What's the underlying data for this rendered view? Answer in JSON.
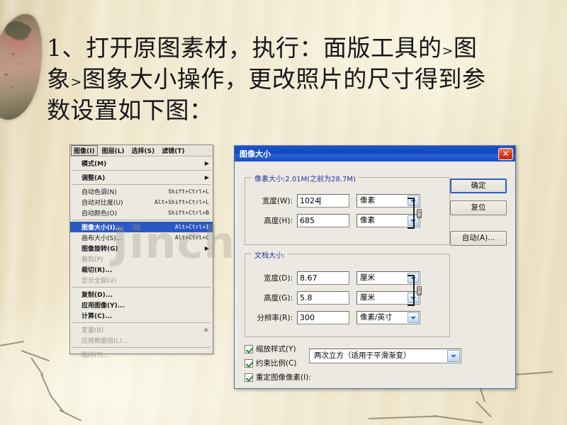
{
  "slide": {
    "headline_line1": "1、打开原图素材，执行：面版工具的",
    "headline_small1": ">",
    "headline_line1b": "图",
    "headline_line2a": "象",
    "headline_small2": ">",
    "headline_line2b": "图象大小操作，更改照片的尺寸得到参",
    "headline_line3": "数设置如下图：",
    "watermark": "Jinchutou.com",
    "accent_blue": "#1147bd",
    "highlight_blue": "#2b59c4",
    "paper_color": "#efe6c9"
  },
  "menu_panel": {
    "menubar": [
      {
        "label": "图像(I)",
        "selected": true
      },
      {
        "label": "图层(L)",
        "selected": false
      },
      {
        "label": "选择(S)",
        "selected": false
      },
      {
        "label": "滤镜(T)",
        "selected": false
      }
    ],
    "items": [
      {
        "label": "模式(M)",
        "accel": "",
        "arrow": "▶",
        "state": "bold",
        "sep_after": true
      },
      {
        "label": "调整(A)",
        "accel": "",
        "arrow": "▶",
        "state": "bold",
        "sep_after": true
      },
      {
        "label": "自动色调(N)",
        "accel": "Shift+Ctrl+L",
        "arrow": "",
        "state": "normal",
        "sep_after": false
      },
      {
        "label": "自动对比度(U)",
        "accel": "Alt+Shift+Ctrl+L",
        "arrow": "",
        "state": "normal",
        "sep_after": false
      },
      {
        "label": "自动颜色(O)",
        "accel": "Shift+Ctrl+B",
        "arrow": "",
        "state": "normal",
        "sep_after": true
      },
      {
        "label": "图像大小(I)...",
        "accel": "Alt+Ctrl+I",
        "arrow": "",
        "state": "highlight",
        "sep_after": false
      },
      {
        "label": "画布大小(S)...",
        "accel": "Alt+Ctrl+C",
        "arrow": "",
        "state": "normal",
        "sep_after": false
      },
      {
        "label": "图像旋转(G)",
        "accel": "",
        "arrow": "▶",
        "state": "bold",
        "sep_after": false
      },
      {
        "label": "裁剪(P)",
        "accel": "",
        "arrow": "",
        "state": "dim",
        "sep_after": false
      },
      {
        "label": "裁切(R)...",
        "accel": "",
        "arrow": "",
        "state": "bold",
        "sep_after": false
      },
      {
        "label": "显示全部(V)",
        "accel": "",
        "arrow": "",
        "state": "dim",
        "sep_after": true
      },
      {
        "label": "复制(D)...",
        "accel": "",
        "arrow": "",
        "state": "bold",
        "sep_after": false
      },
      {
        "label": "应用图像(Y)...",
        "accel": "",
        "arrow": "",
        "state": "bold",
        "sep_after": false
      },
      {
        "label": "计算(C)...",
        "accel": "",
        "arrow": "",
        "state": "bold",
        "sep_after": true
      },
      {
        "label": "变量(B)",
        "accel": "",
        "arrow": "▶",
        "state": "dim",
        "sep_after": false
      },
      {
        "label": "应用数据组(L)...",
        "accel": "",
        "arrow": "",
        "state": "dim",
        "sep_after": true
      },
      {
        "label": "陷印(T)...",
        "accel": "",
        "arrow": "",
        "state": "dim",
        "sep_after": false
      }
    ]
  },
  "dialog": {
    "title": "图像大小",
    "close_icon": "✕",
    "pixel_group": {
      "title": "像素大小:2.01M(之前为28.7M)",
      "width_label": "宽度(W):",
      "width_value": "1024",
      "width_unit": "像素",
      "height_label": "高度(H):",
      "height_value": "685",
      "height_unit": "像素"
    },
    "doc_group": {
      "title": "文档大小:",
      "width_label": "宽度(D):",
      "width_value": "8.67",
      "width_unit": "厘米",
      "height_label": "高度(G):",
      "height_value": "5.8",
      "height_unit": "厘米",
      "res_label": "分辨率(R):",
      "res_value": "300",
      "res_unit": "像素/英寸"
    },
    "checkboxes": [
      {
        "label": "缩放样式(Y)",
        "checked": true
      },
      {
        "label": "约束比例(C)",
        "checked": true
      },
      {
        "label": "重定图像像素(I):",
        "checked": true
      }
    ],
    "resample_method": "两次立方（适用于平滑渐变）",
    "buttons": [
      {
        "label": "确定",
        "default": true
      },
      {
        "label": "复位",
        "default": false
      },
      {
        "label": "自动(A)...",
        "default": false
      }
    ]
  }
}
